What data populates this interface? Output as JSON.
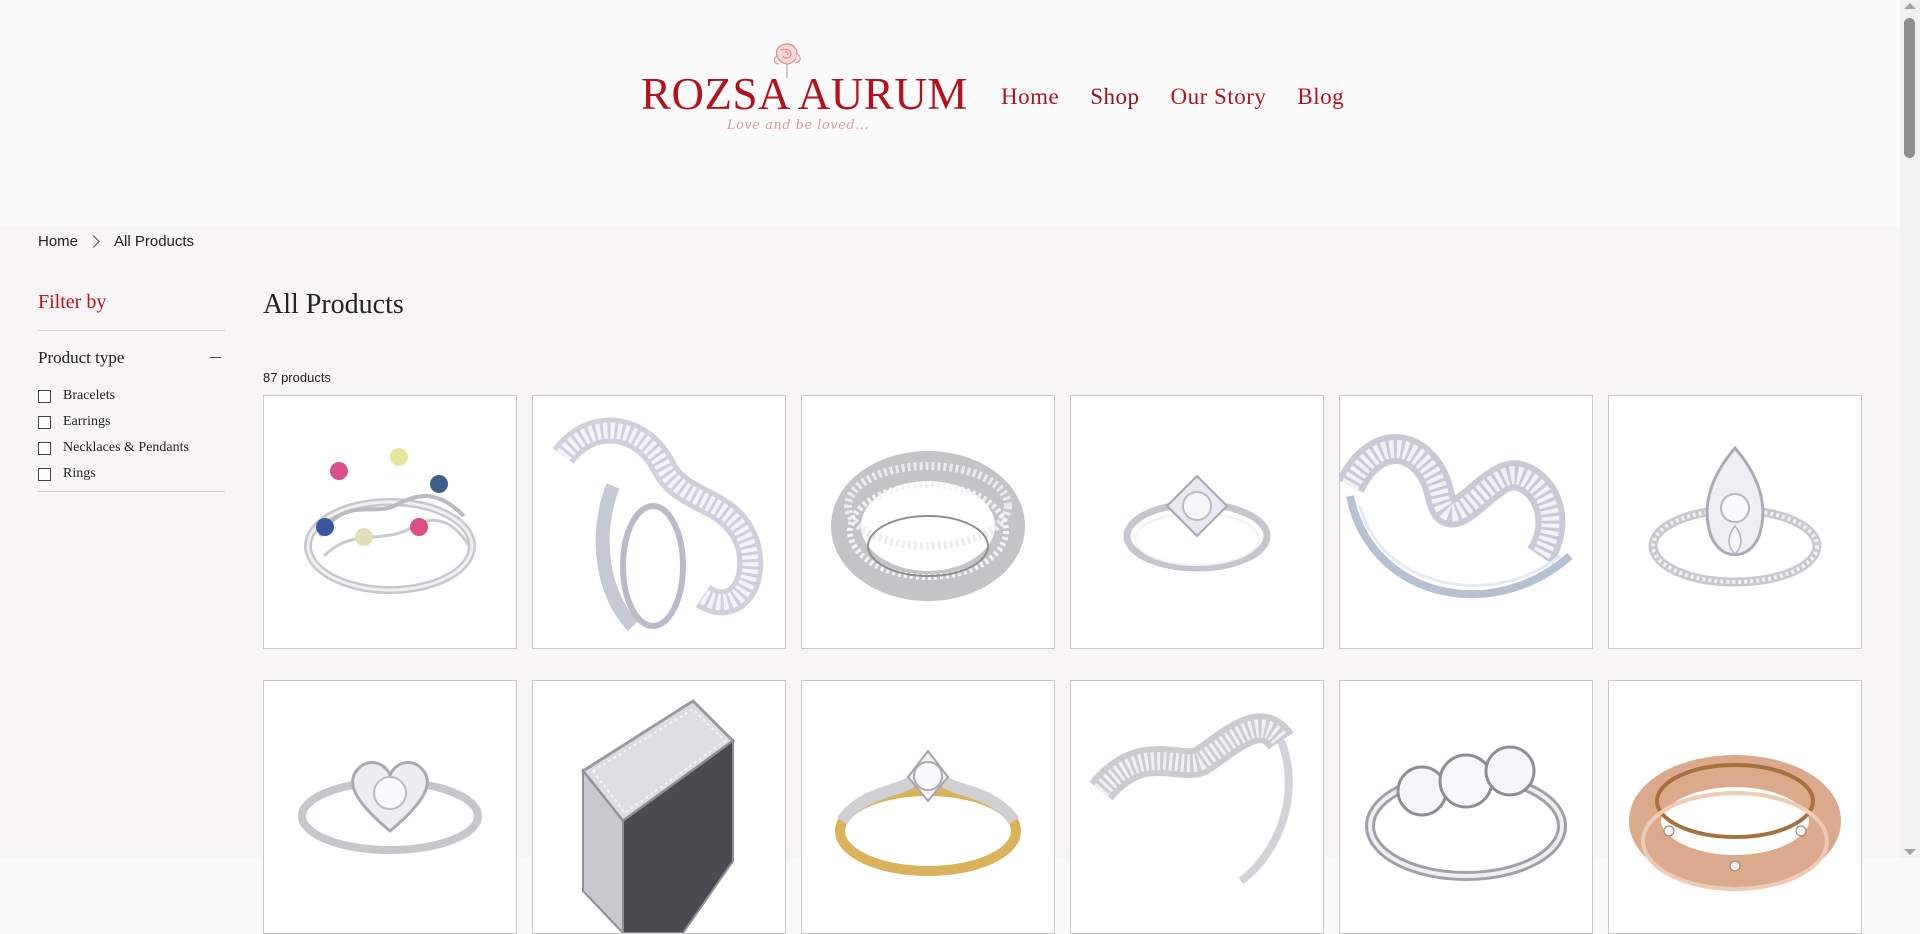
{
  "brand": {
    "name": "ROZSA AURUM",
    "tagline": "Love and be loved..."
  },
  "nav": {
    "items": [
      {
        "label": "Home"
      },
      {
        "label": "Shop"
      },
      {
        "label": "Our Story"
      },
      {
        "label": "Blog"
      }
    ]
  },
  "breadcrumb": {
    "home": "Home",
    "current": "All Products"
  },
  "filter": {
    "title": "Filter by",
    "facet_title": "Product type",
    "options": [
      {
        "label": "Bracelets"
      },
      {
        "label": "Earrings"
      },
      {
        "label": "Necklaces & Pendants"
      },
      {
        "label": "Rings"
      }
    ]
  },
  "catalog": {
    "title": "All Products",
    "count": "87 products",
    "products": [
      {
        "image": "ring-colored-gems"
      },
      {
        "image": "ring-baguette-swirl"
      },
      {
        "image": "ring-pave-band"
      },
      {
        "image": "ring-solitaire-cathedral"
      },
      {
        "image": "ring-baguette-ribbon"
      },
      {
        "image": "ring-marquise-halo"
      },
      {
        "image": "ring-heart-halo"
      },
      {
        "image": "ring-pave-signet"
      },
      {
        "image": "ring-two-tone-solitaire"
      },
      {
        "image": "ring-pave-wave"
      },
      {
        "image": "ring-three-stone"
      },
      {
        "image": "ring-rose-gold-band"
      }
    ]
  },
  "colors": {
    "brand_red": "#b3121d",
    "tagline_pink": "#e09a9c"
  }
}
